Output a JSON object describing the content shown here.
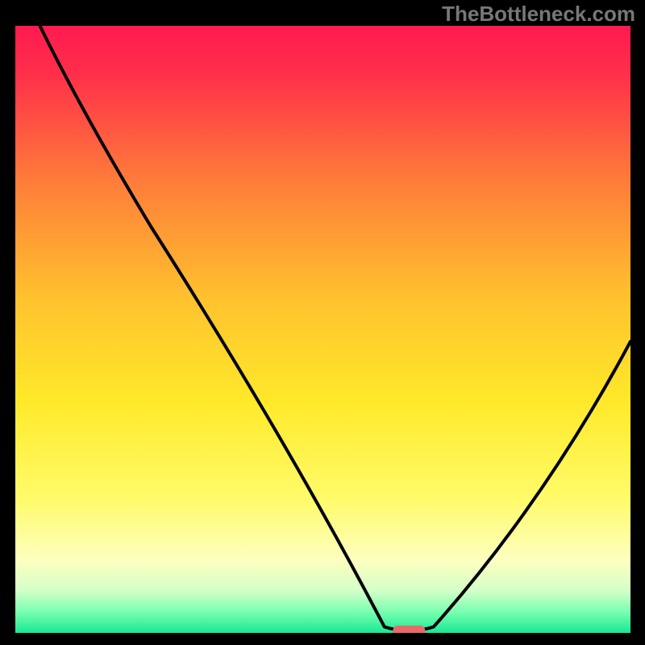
{
  "watermark": "TheBottleneck.com",
  "chart_data": {
    "type": "line",
    "title": "",
    "xlabel": "",
    "ylabel": "",
    "xlim": [
      0,
      100
    ],
    "ylim": [
      0,
      100
    ],
    "optimum_x": 64,
    "optimum_y": 0,
    "left_start": {
      "x": 4,
      "y": 100
    },
    "right_end": {
      "x": 100,
      "y": 48
    },
    "curve_points": [
      {
        "x": 4,
        "y": 100
      },
      {
        "x": 22,
        "y": 67
      },
      {
        "x": 60,
        "y": 1
      },
      {
        "x": 64,
        "y": 0
      },
      {
        "x": 68,
        "y": 1
      },
      {
        "x": 100,
        "y": 48
      }
    ],
    "marker": {
      "x": 64,
      "y": 0,
      "color": "#e86a6a"
    },
    "gradient_stops": [
      {
        "offset": 0.0,
        "color": "#ff1a50"
      },
      {
        "offset": 0.08,
        "color": "#ff2f4a"
      },
      {
        "offset": 0.25,
        "color": "#ff7a3a"
      },
      {
        "offset": 0.45,
        "color": "#ffc22e"
      },
      {
        "offset": 0.62,
        "color": "#ffe92a"
      },
      {
        "offset": 0.78,
        "color": "#fffb6a"
      },
      {
        "offset": 0.88,
        "color": "#fdffbf"
      },
      {
        "offset": 0.93,
        "color": "#d4ffc8"
      },
      {
        "offset": 0.965,
        "color": "#7affb0"
      },
      {
        "offset": 1.0,
        "color": "#18e893"
      }
    ],
    "border_color": "#000000",
    "curve_color": "#000000"
  }
}
